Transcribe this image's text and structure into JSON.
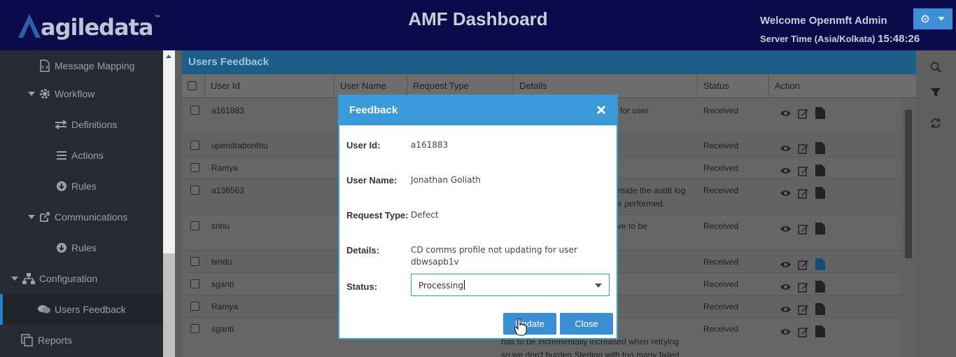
{
  "header": {
    "logo_text": "agiledata",
    "logo_tm": "™",
    "title": "AMF Dashboard",
    "welcome": "Welcome Openmft Admin",
    "server_time_label": "Server Time (Asia/Kolkata)",
    "server_time_value": "15:48:26"
  },
  "sidebar": {
    "items": [
      {
        "label": "Message Mapping"
      },
      {
        "label": "Workflow"
      },
      {
        "label": "Definitions"
      },
      {
        "label": "Actions"
      },
      {
        "label": "Rules"
      },
      {
        "label": "Communications"
      },
      {
        "label": "Rules"
      },
      {
        "label": "Configuration"
      },
      {
        "label": "Users Feedback"
      },
      {
        "label": "Reports"
      }
    ]
  },
  "panel": {
    "title": "Users Feedback",
    "columns": [
      "User Id",
      "User Name",
      "Request Type",
      "Details",
      "Status",
      "Action"
    ],
    "rows": [
      {
        "user_id": "a161883",
        "details": "for user",
        "status": "Received"
      },
      {
        "user_id": "upendrabonthu",
        "details": "",
        "status": "Received"
      },
      {
        "user_id": "Ramya",
        "details": "",
        "status": "Received"
      },
      {
        "user_id": "a136563",
        "details": "nside the audit log\ne performed.",
        "status": "Received"
      },
      {
        "user_id": "srinu",
        "details": "ve to be",
        "status": "Received"
      },
      {
        "user_id": "bindu",
        "details": "",
        "status": "Received"
      },
      {
        "user_id": "sganti",
        "details": "",
        "status": "Received"
      },
      {
        "user_id": "Ramya",
        "details": "",
        "status": "Received"
      },
      {
        "user_id": "sganti",
        "details": "n Delivery Queue\nhas to be incrementally increased when retrying\nso we don't burden Sterling with too many failed",
        "status": "Received"
      }
    ]
  },
  "modal": {
    "title": "Feedback",
    "fields": {
      "user_id_label": "User Id:",
      "user_id_value": "a161883",
      "user_name_label": "User Name:",
      "user_name_value": "Jonathan Goliath",
      "request_type_label": "Request Type:",
      "request_type_value": "Defect",
      "details_label": "Details:",
      "details_value": "CD comms profile not updating for user dbwsapb1v",
      "status_label": "Status:",
      "status_value": "Processing"
    },
    "update_label": "Update",
    "close_label": "Close"
  },
  "icons": {
    "sidebar": [
      "document-code-icon",
      "gear-icon",
      "exchange-icon",
      "list-icon",
      "circle-arrow-icon",
      "share-icon",
      "circle-arrow-icon",
      "sitemap-icon",
      "comments-icon",
      "copy-icon"
    ],
    "row_actions": [
      "eye-icon",
      "edit-icon",
      "file-icon"
    ],
    "right_bar": [
      "search-icon",
      "filter-icon",
      "refresh-icon"
    ]
  },
  "colors": {
    "header_bg": "#0b0b4a",
    "sidebar_bg": "#262b32",
    "accent": "#3a9ad9",
    "button": "#3a8fd4"
  }
}
